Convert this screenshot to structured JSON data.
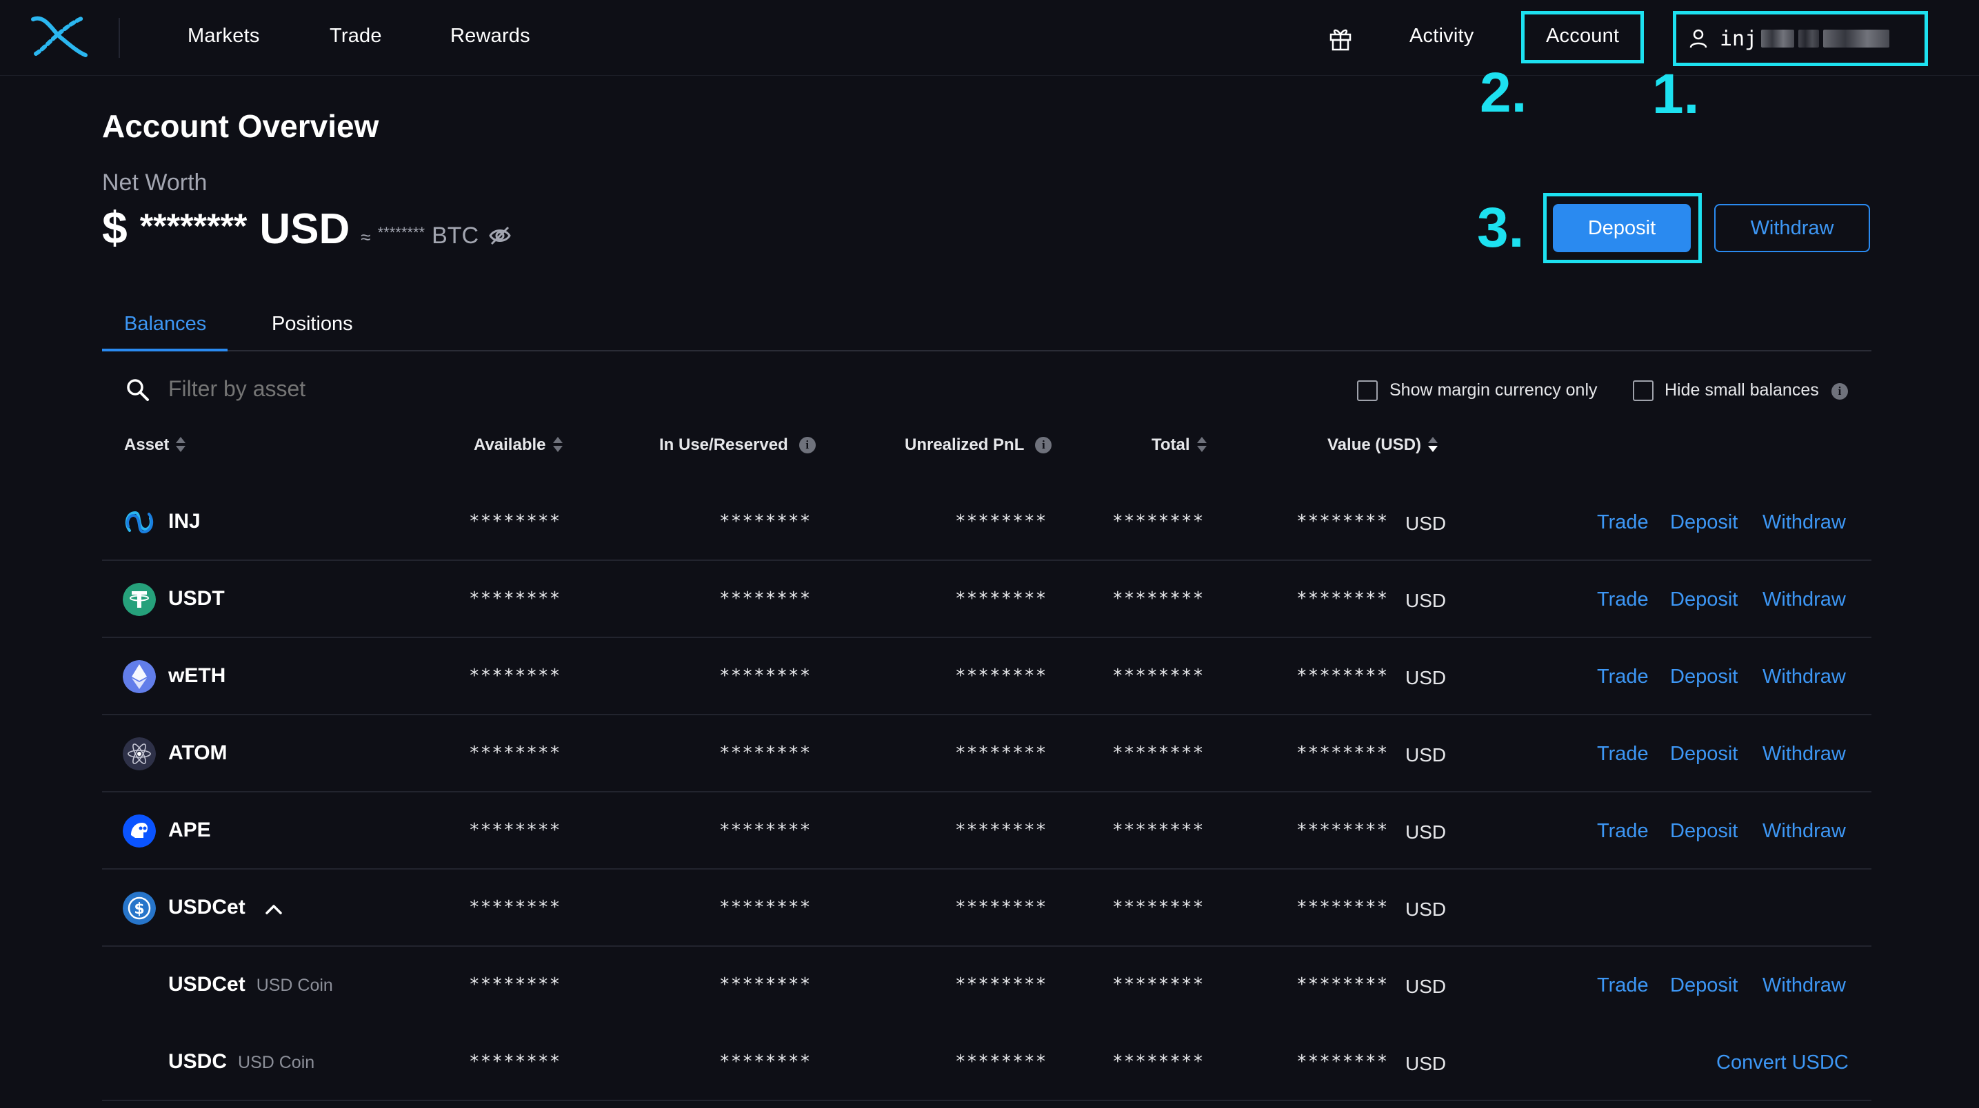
{
  "nav": {
    "links": [
      "Markets",
      "Trade",
      "Rewards"
    ],
    "activity": "Activity",
    "account": "Account",
    "wallet_prefix": "inj"
  },
  "annotations": [
    "1.",
    "2.",
    "3."
  ],
  "overview": {
    "title": "Account Overview",
    "net_worth_label": "Net Worth",
    "dollar": "$",
    "masked_value": "********",
    "currency": "USD",
    "approx": "≈",
    "btc_masked": "********",
    "btc": "BTC"
  },
  "buttons": {
    "deposit": "Deposit",
    "withdraw": "Withdraw"
  },
  "tabs": [
    "Balances",
    "Positions"
  ],
  "filter": {
    "placeholder": "Filter by asset",
    "show_margin": "Show margin currency only",
    "hide_small": "Hide small balances"
  },
  "columns": [
    "Asset",
    "Available",
    "In Use/Reserved",
    "Unrealized PnL",
    "Total",
    "Value (USD)"
  ],
  "masked": "********",
  "usd": "USD",
  "actions": {
    "trade": "Trade",
    "deposit": "Deposit",
    "withdraw": "Withdraw",
    "convert": "Convert USDC"
  },
  "rows": [
    {
      "name": "INJ"
    },
    {
      "name": "USDT"
    },
    {
      "name": "wETH"
    },
    {
      "name": "ATOM"
    },
    {
      "name": "APE"
    },
    {
      "name": "USDCet"
    },
    {
      "name": "USDCet",
      "sub": "USD Coin"
    },
    {
      "name": "USDC",
      "sub": "USD Coin"
    }
  ],
  "colors": {
    "accent": "#2a8af0",
    "annotation": "#1de1f0",
    "background": "#0e0f16"
  }
}
